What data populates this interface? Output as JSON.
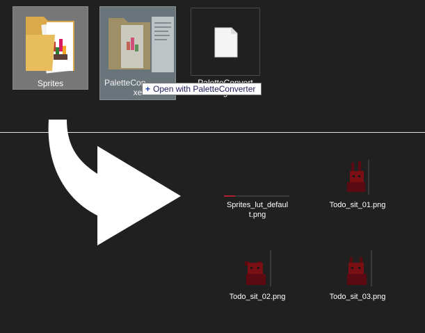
{
  "source_files": [
    {
      "name_lines": [
        "Sprites"
      ],
      "type": "folder",
      "selected": true
    },
    {
      "name_lines": [
        "PaletteCon",
        "xe"
      ],
      "type": "exe",
      "dragging": true
    },
    {
      "name_lines": [
        "PaletteConvert",
        "g"
      ],
      "type": "file",
      "selected": false
    }
  ],
  "tooltip": {
    "text": "Open with PaletteConverter",
    "icon": "plus-icon"
  },
  "arrow": {
    "icon": "curved-arrow-icon",
    "color": "#ffffff"
  },
  "output_files": [
    {
      "name_lines": [
        "Sprites_lut_defaul",
        "t.png"
      ]
    },
    {
      "name_lines": [
        "Todo_sit_01.png"
      ]
    },
    {
      "name_lines": [
        "Todo_sit_02.png"
      ]
    },
    {
      "name_lines": [
        "Todo_sit_03.png"
      ]
    }
  ],
  "colors": {
    "background": "#202020",
    "tooltip_text": "#1c1c5c",
    "sprite_red": "#7a0f14"
  }
}
